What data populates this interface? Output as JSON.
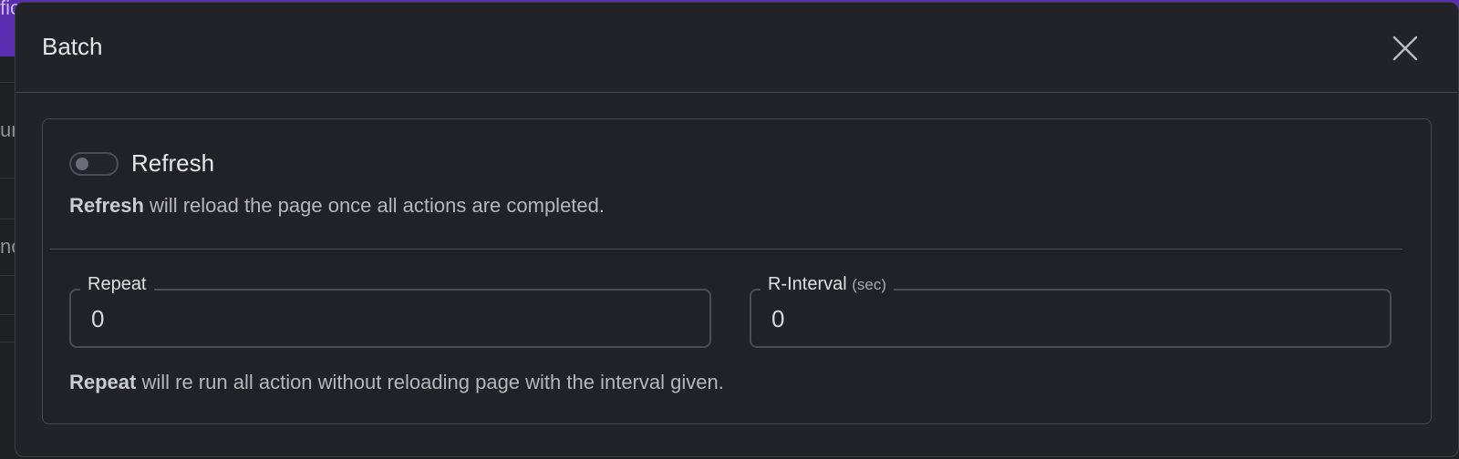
{
  "background": {
    "partial_texts": [
      "fic",
      "ur",
      "nc"
    ],
    "header_color": "#5b2db0"
  },
  "modal": {
    "title": "Batch",
    "close_icon": "close-icon",
    "refresh": {
      "label": "Refresh",
      "enabled": false,
      "desc_bold": "Refresh",
      "desc_rest": " will reload the page once all actions are completed."
    },
    "repeat": {
      "label": "Repeat",
      "value": "0"
    },
    "interval": {
      "label": "R-Interval",
      "unit": "(sec)",
      "value": "0"
    },
    "repeat_desc_bold": "Repeat",
    "repeat_desc_rest": " will re run all action without reloading page with the interval given."
  }
}
